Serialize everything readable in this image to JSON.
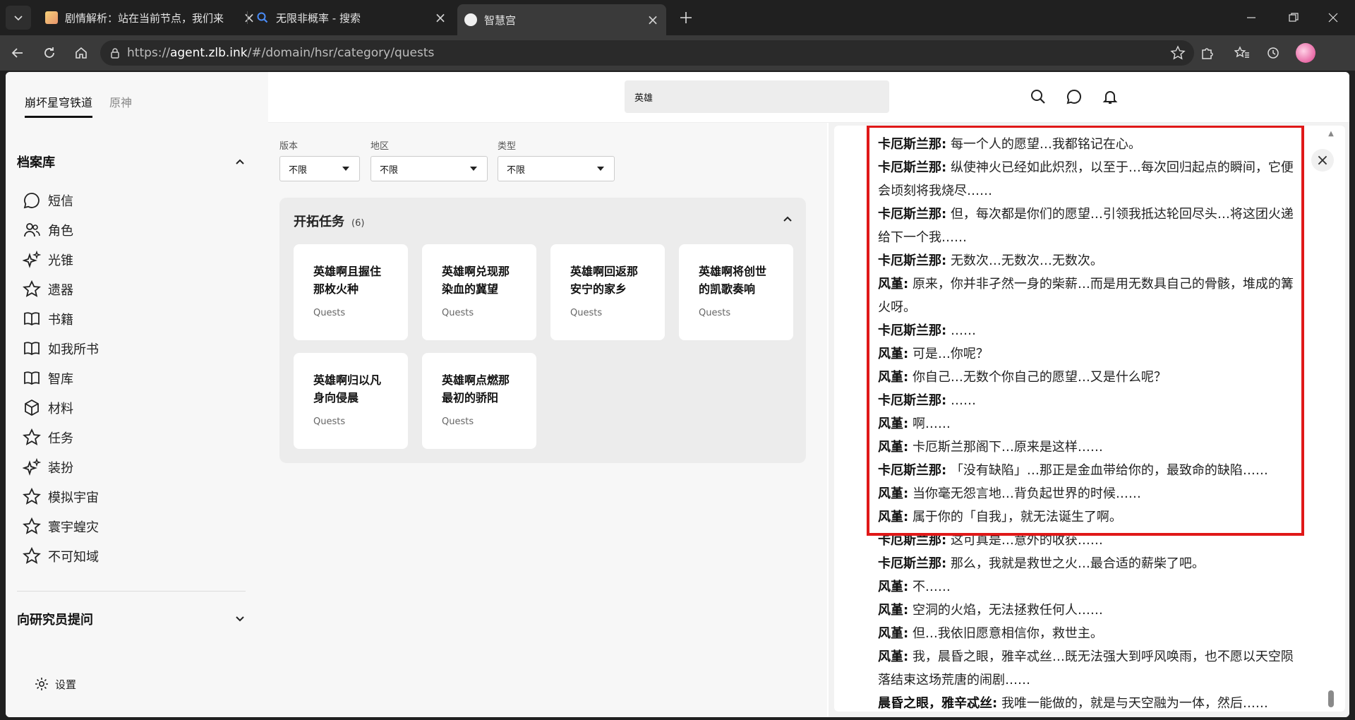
{
  "browser": {
    "tabs": [
      {
        "title": "剧情解析：站在当前节点，我们来"
      },
      {
        "title": "无限非概率 - 搜索"
      },
      {
        "title": "智慧宫"
      }
    ],
    "url_prefix": "https://",
    "url_host": "agent.zlb.ink",
    "url_path": "/#/domain/hsr/category/quests"
  },
  "sidebar": {
    "game_tabs": [
      "崩坏星穹铁道",
      "原神"
    ],
    "archive_title": "档案库",
    "items": [
      {
        "label": "短信",
        "icon": "chat-bubble-icon"
      },
      {
        "label": "角色",
        "icon": "people-icon"
      },
      {
        "label": "光锥",
        "icon": "sparkles-icon"
      },
      {
        "label": "遗器",
        "icon": "star-icon"
      },
      {
        "label": "书籍",
        "icon": "book-icon"
      },
      {
        "label": "如我所书",
        "icon": "book-icon"
      },
      {
        "label": "智库",
        "icon": "book-icon"
      },
      {
        "label": "材料",
        "icon": "cube-icon"
      },
      {
        "label": "任务",
        "icon": "star-icon"
      },
      {
        "label": "装扮",
        "icon": "sparkles-icon"
      },
      {
        "label": "模拟宇宙",
        "icon": "star-icon"
      },
      {
        "label": "寰宇蝗灾",
        "icon": "star-icon"
      },
      {
        "label": "不可知域",
        "icon": "star-icon"
      }
    ],
    "ask_title": "向研究员提问",
    "settings_label": "设置"
  },
  "header": {
    "search_value": "英雄"
  },
  "filters": [
    {
      "label": "版本",
      "value": "不限"
    },
    {
      "label": "地区",
      "value": "不限"
    },
    {
      "label": "类型",
      "value": "不限"
    }
  ],
  "quests": {
    "title": "开拓任务",
    "count": "(6)",
    "cards": [
      {
        "title": "英雄啊且握住那枚火种",
        "sub": "Quests"
      },
      {
        "title": "英雄啊兑现那染血的冀望",
        "sub": "Quests"
      },
      {
        "title": "英雄啊回返那安宁的家乡",
        "sub": "Quests"
      },
      {
        "title": "英雄啊将创世的凯歌奏响",
        "sub": "Quests"
      },
      {
        "title": "英雄啊归以凡身向侵晨",
        "sub": "Quests"
      },
      {
        "title": "英雄啊点燃那最初的骄阳",
        "sub": "Quests"
      }
    ]
  },
  "dialogue": [
    {
      "speaker": "卡厄斯兰那:",
      "text": "每一个人的愿望…我都铭记在心。"
    },
    {
      "speaker": "卡厄斯兰那:",
      "text": "纵使神火已经如此炽烈，以至于…每次回归起点的瞬间，它便会顷刻将我烧尽……"
    },
    {
      "speaker": "卡厄斯兰那:",
      "text": "但，每次都是你们的愿望…引领我抵达轮回尽头…将这团火递给下一个我……"
    },
    {
      "speaker": "卡厄斯兰那:",
      "text": "无数次…无数次…无数次。"
    },
    {
      "speaker": "风堇:",
      "text": "原来，你并非孑然一身的柴薪…而是用无数具自己的骨骸，堆成的篝火呀。"
    },
    {
      "speaker": "卡厄斯兰那:",
      "text": "……"
    },
    {
      "speaker": "风堇:",
      "text": "可是…你呢？"
    },
    {
      "speaker": "风堇:",
      "text": "你自己…无数个你自己的愿望…又是什么呢？"
    },
    {
      "speaker": "卡厄斯兰那:",
      "text": "……"
    },
    {
      "speaker": "风堇:",
      "text": "啊……"
    },
    {
      "speaker": "风堇:",
      "text": "卡厄斯兰那阁下…原来是这样……"
    },
    {
      "speaker": "卡厄斯兰那:",
      "text": "「没有缺陷」…那正是金血带给你的，最致命的缺陷……"
    },
    {
      "speaker": "风堇:",
      "text": "当你毫无怨言地…背负起世界的时候……"
    },
    {
      "speaker": "风堇:",
      "text": "属于你的「自我」，就无法诞生了啊。"
    },
    {
      "speaker": "卡厄斯兰那:",
      "text": "这可真是…意外的收获……"
    },
    {
      "speaker": "卡厄斯兰那:",
      "text": "那么，我就是救世之火…最合适的薪柴了吧。"
    },
    {
      "speaker": "风堇:",
      "text": "不……"
    },
    {
      "speaker": "风堇:",
      "text": "空洞的火焰，无法拯救任何人……"
    },
    {
      "speaker": "风堇:",
      "text": "但…我依旧愿意相信你，救世主。"
    },
    {
      "speaker": "风堇:",
      "text": "我，晨昏之眼，雅辛忒丝…既无法强大到呼风唤雨，也不愿以天空陨落结束这场荒唐的闹剧……"
    },
    {
      "speaker": "晨昏之眼，雅辛忒丝:",
      "text": "我唯一能做的，就是与天空融为一体，然后……"
    }
  ],
  "colors": {
    "highlight": "#e01818",
    "browser_dark": "#202020"
  }
}
